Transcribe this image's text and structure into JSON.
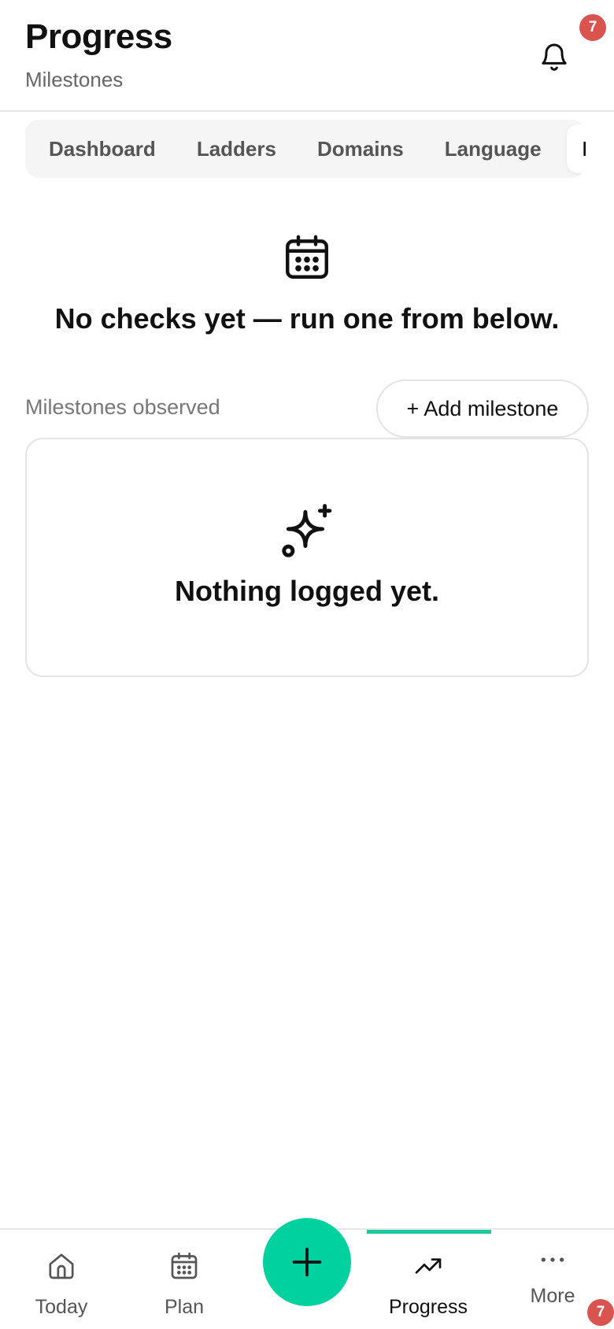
{
  "header": {
    "title": "Progress",
    "subtitle": "Milestones",
    "notification_count": "7"
  },
  "tabs": [
    {
      "label": "Dashboard",
      "active": false
    },
    {
      "label": "Ladders",
      "active": false
    },
    {
      "label": "Domains",
      "active": false
    },
    {
      "label": "Language",
      "active": false
    },
    {
      "label": "Milestones",
      "active": true
    }
  ],
  "checks": {
    "icon": "calendar-icon",
    "empty_message": "No checks yet — run one from below."
  },
  "milestones": {
    "section_label": "Milestones observed",
    "add_button_label": "+ Add milestone",
    "empty_icon": "sparkle-icon",
    "empty_message": "Nothing logged yet."
  },
  "bottom_nav": {
    "items": [
      {
        "label": "Today",
        "icon": "home-icon",
        "active": false
      },
      {
        "label": "Plan",
        "icon": "calendar-icon",
        "active": false
      },
      {
        "label": "Progress",
        "icon": "trending-up-icon",
        "active": true
      },
      {
        "label": "More",
        "icon": "more-dots-icon",
        "active": false
      }
    ],
    "fab_icon": "plus-icon",
    "more_badge_count": "7"
  },
  "colors": {
    "accent": "#00d19f",
    "active_indicator": "#1fc9a0",
    "badge": "#d9534f"
  }
}
